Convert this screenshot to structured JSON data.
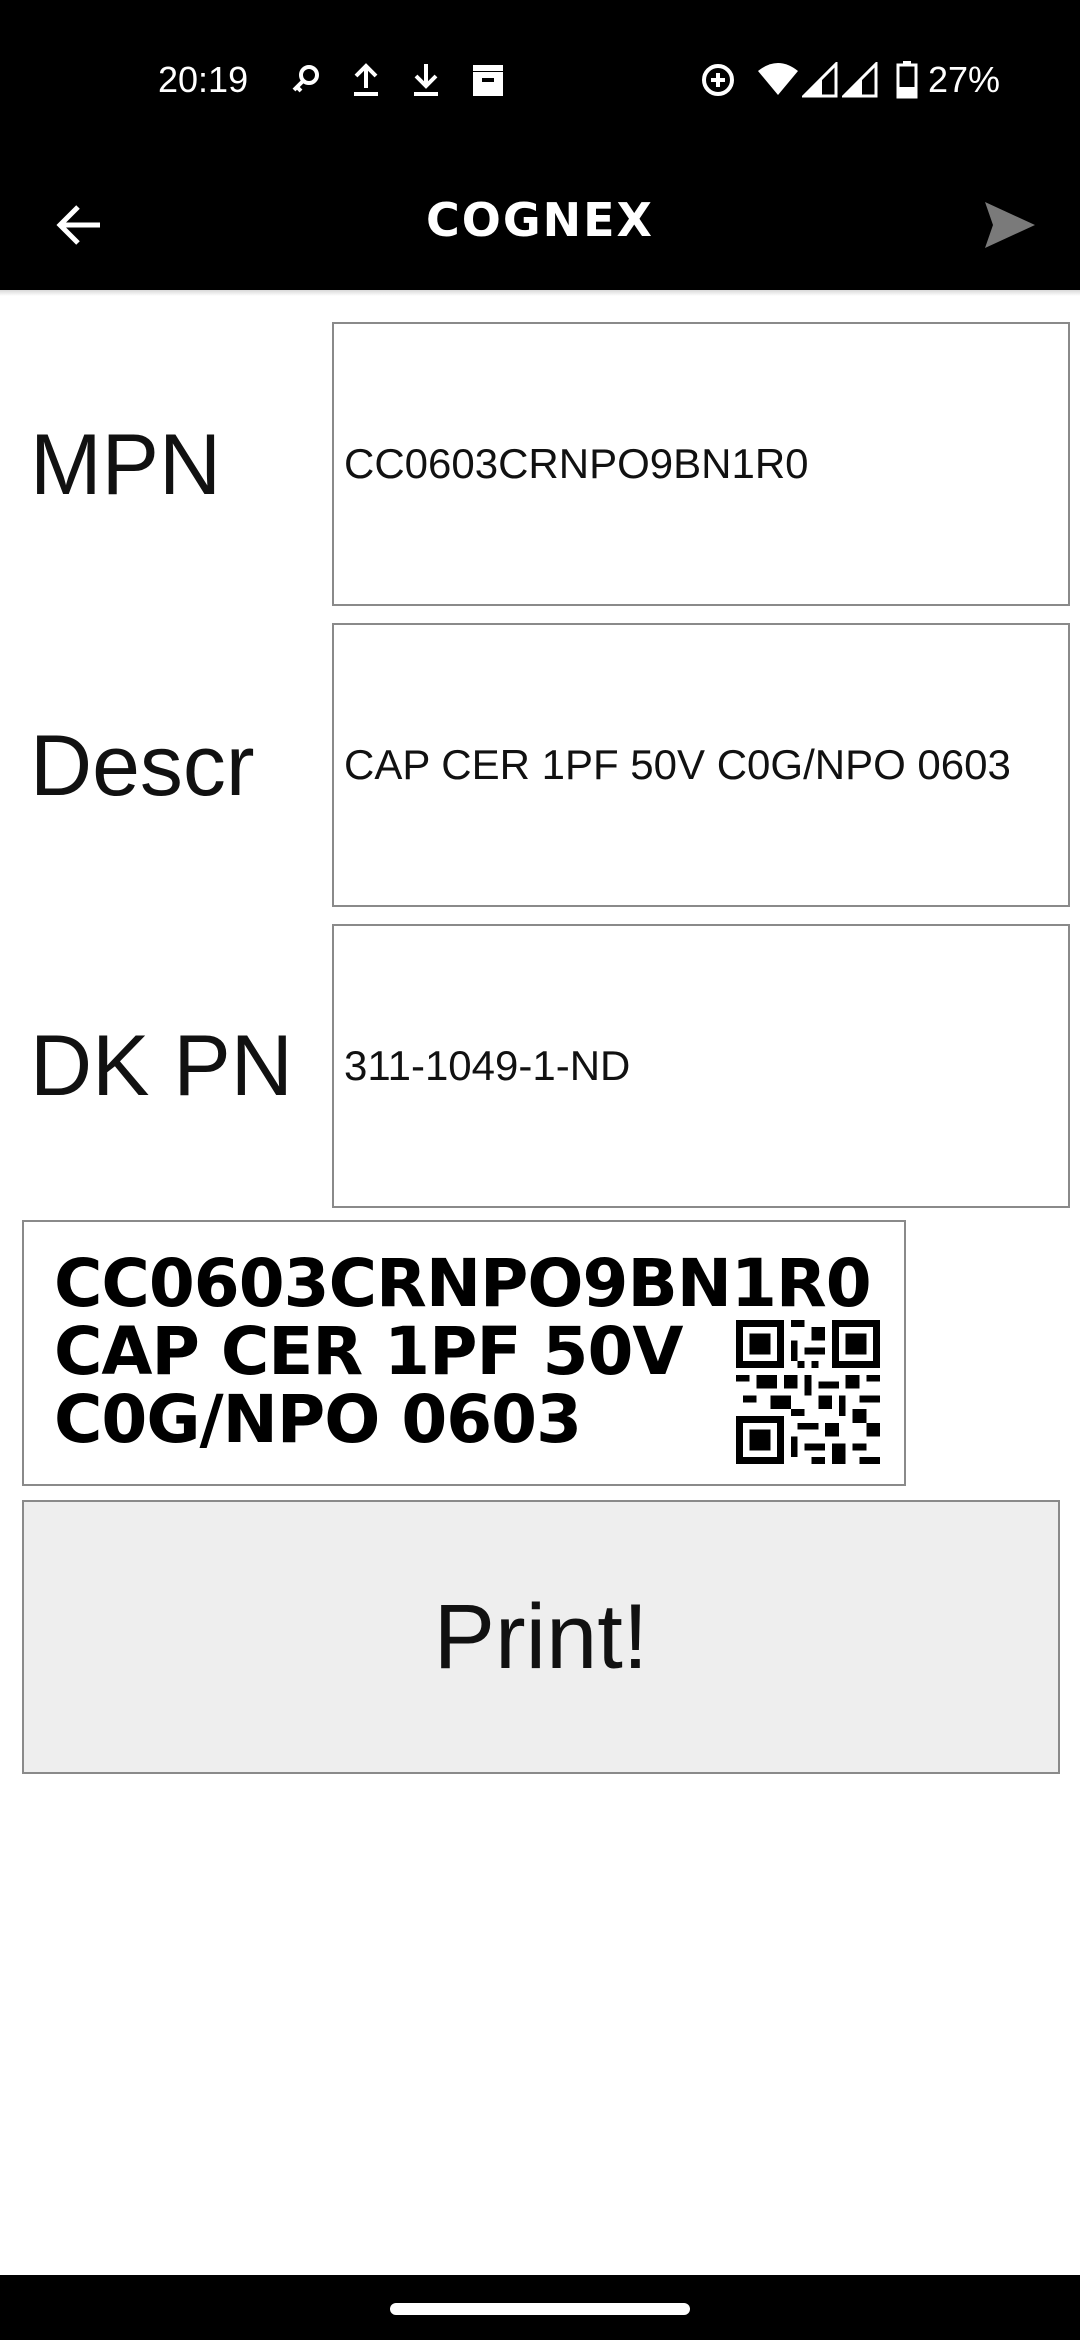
{
  "status_bar": {
    "time": "20:19",
    "battery": "27%",
    "icons": [
      "key-icon",
      "upload-icon",
      "download-icon",
      "store-icon",
      "data-saver-icon",
      "wifi-icon",
      "signal-icon",
      "signal-icon",
      "battery-icon"
    ]
  },
  "app_bar": {
    "title": "COGNEX",
    "back_icon": "arrow-left-icon",
    "send_icon": "send-icon"
  },
  "form": {
    "mpn": {
      "label": "MPN",
      "value": "CC0603CRNPO9BN1R0"
    },
    "descr": {
      "label": "Descr",
      "value": "CAP CER 1PF 50V C0G/NPO 0603"
    },
    "dkpn": {
      "label": "DK PN",
      "value": "311-1049-1-ND"
    }
  },
  "label_preview": {
    "lines": [
      "CC0603CRNPO9BN1R0",
      "CAP CER 1PF 50V",
      "C0G/NPO 0603"
    ]
  },
  "actions": {
    "print_label": "Print!"
  },
  "colors": {
    "bar_bg": "#000000",
    "button_bg": "#eeeeee",
    "border": "#8a8a8a"
  }
}
